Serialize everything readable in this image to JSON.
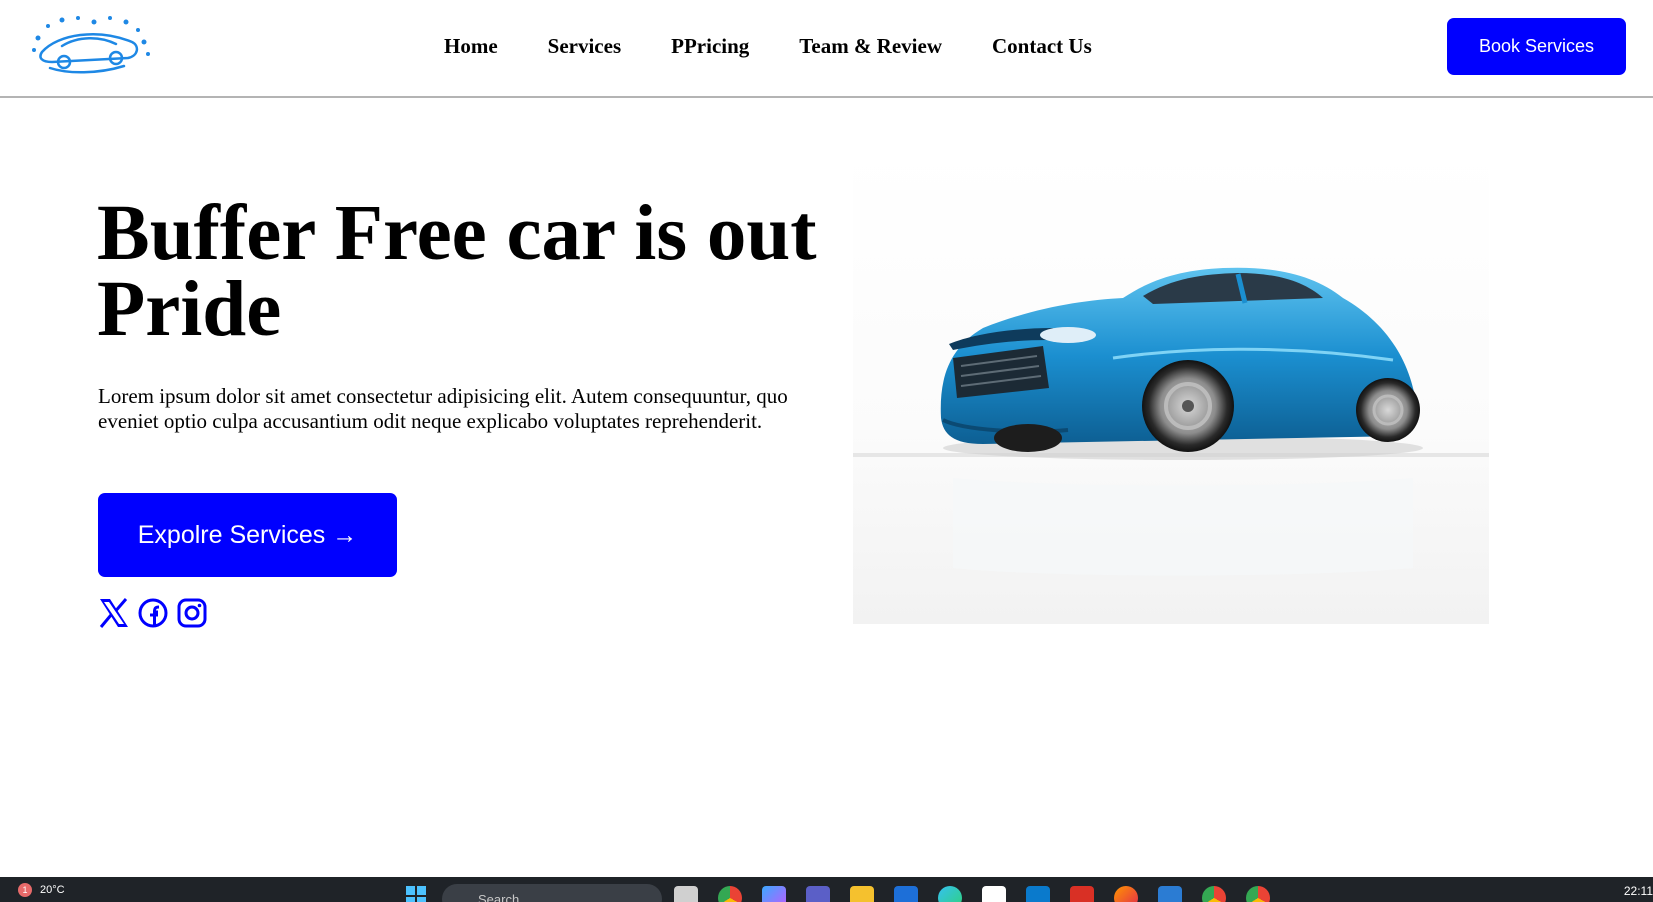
{
  "header": {
    "nav": [
      {
        "label": "Home"
      },
      {
        "label": "Services"
      },
      {
        "label": "PPricing"
      },
      {
        "label": "Team & Review"
      },
      {
        "label": "Contact Us"
      }
    ],
    "book_button": "Book Services",
    "logo_icon": "car-wash-logo",
    "colors": {
      "accent": "#0000ff",
      "logo": "#1e88e5"
    }
  },
  "hero": {
    "title": "Buffer Free car is out Pride",
    "text": "Lorem ipsum dolor sit amet consectetur adipisicing elit. Autem consequuntur, quo eveniet optio culpa accusantium odit neque explicabo voluptates reprehenderit.",
    "cta": "Expolre Services →",
    "socials": [
      "x-icon",
      "facebook-icon",
      "instagram-icon"
    ],
    "image": {
      "icon": "blue-sports-car-image",
      "car_color": "#1b8fd0"
    }
  },
  "taskbar": {
    "badge": "1",
    "weather": "20°C",
    "search_placeholder": "Search",
    "time": "22:11",
    "apps": [
      "files-icon",
      "chrome-icon",
      "copilot-icon",
      "teams-icon",
      "folder-icon",
      "vscode-alt-icon",
      "edge-icon",
      "store-icon",
      "vscode-icon",
      "gmail-icon",
      "firefox-icon",
      "word-icon",
      "chrome-profile-icon",
      "chrome-user-icon"
    ]
  }
}
